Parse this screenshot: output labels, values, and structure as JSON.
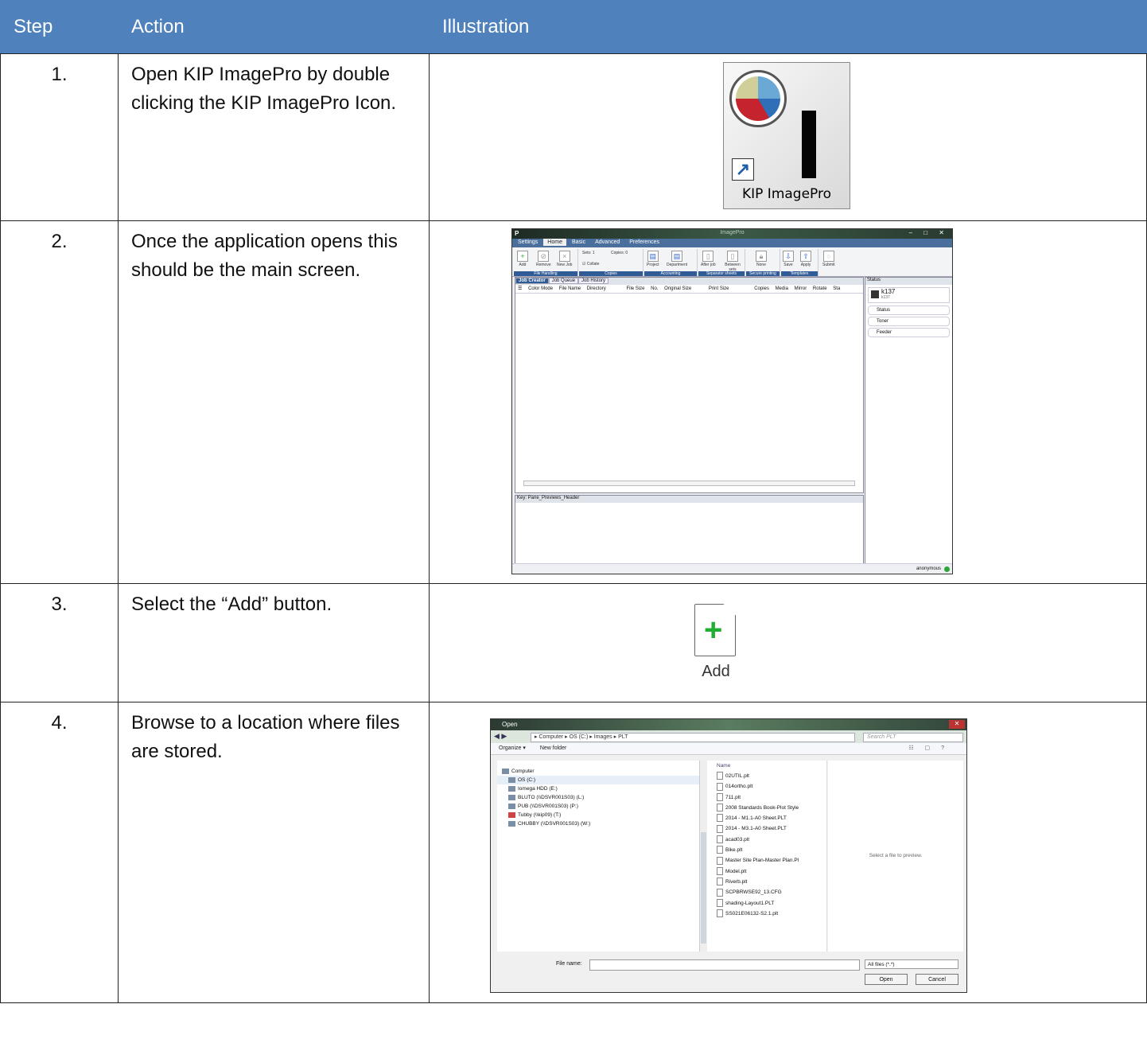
{
  "table": {
    "headers": [
      "Step",
      "Action",
      "Illustration"
    ],
    "colors": {
      "header_bg": "#4f81bd",
      "header_text": "#ffffff"
    },
    "rows": [
      {
        "step": "1.",
        "action": "Open KIP ImagePro by double clicking the KIP ImagePro Icon."
      },
      {
        "step": "2.",
        "action": "Once the application opens this should be the main screen."
      },
      {
        "step": "3.",
        "action": "Select the “Add” button."
      },
      {
        "step": "4.",
        "action": "Browse to a location where files are stored."
      }
    ]
  },
  "illus1": {
    "label": "KIP ImagePro",
    "icon": "kip-imagepro-app-icon"
  },
  "illus2": {
    "title": "ImagePro",
    "tabs": [
      "Settings",
      "Home",
      "Basic",
      "Advanced",
      "Preferences"
    ],
    "ribbon": {
      "buttons": [
        "Add",
        "Remove",
        "New Job",
        "Sets:",
        "Copies:",
        "Collate",
        "Project",
        "Department",
        "After job",
        "Between sets",
        "None",
        "Save",
        "Apply",
        "Submit"
      ],
      "sets_value": "1",
      "copies_value": "0",
      "groups": [
        "File Handling",
        "Copies",
        "Accounting",
        "Separator sheets",
        "Secure printing",
        "Templates"
      ]
    },
    "pane_tabs": [
      "Job Creator",
      "Job Queue",
      "Job History"
    ],
    "columns": [
      "Color Mode",
      "File Name",
      "Directory",
      "File Size",
      "No.",
      "Original Size",
      "Print Size",
      "Copies",
      "Media",
      "Mirror",
      "Rotate",
      "Sta"
    ],
    "preview_header": "Key: Pane_Previews_Header",
    "status_header": "Status",
    "printer": {
      "name": "k137",
      "sub": "k137"
    },
    "status_rows": [
      "Status",
      "Toner",
      "Feeder"
    ],
    "user": "anonymous"
  },
  "illus3": {
    "label": "Add"
  },
  "illus4": {
    "title": "Open",
    "breadcrumb": "▸ Computer ▸ OS (C:) ▸ Images ▸ PLT",
    "search_placeholder": "Search PLT",
    "toolbar": [
      "Organize ▾",
      "New folder"
    ],
    "nav": [
      "Computer",
      "OS (C:)",
      "Iomega HDD (E:)",
      "BLUTO (\\\\DSVR001S03) (L:)",
      "PUB (\\\\DSVR001S03) (P:)",
      "Tubby (\\\\kip09) (T:)",
      "CHUBBY (\\\\DSVR001S03) (W:)"
    ],
    "name_header": "Name",
    "files": [
      "02UTIL.plt",
      "014ortho.plt",
      "711.plt",
      "2008 Standards Book-Plot Style",
      "2014 - M1.1-A0 Sheet.PLT",
      "2014 - M3.1-A0 Sheet.PLT",
      "acad03.plt",
      "Bike.plt",
      "Master Site Plan-Master Plan.Pl",
      "Model.plt",
      "Riverb.plt",
      "SCPBRWSE92_13.CFG",
      "shading-Layout1.PLT",
      "SS021E06132-S2.1.plt"
    ],
    "preview_text": "Select a file to preview.",
    "file_name_label": "File name:",
    "file_type": "All files (*.*)",
    "open_label": "Open",
    "cancel_label": "Cancel"
  }
}
